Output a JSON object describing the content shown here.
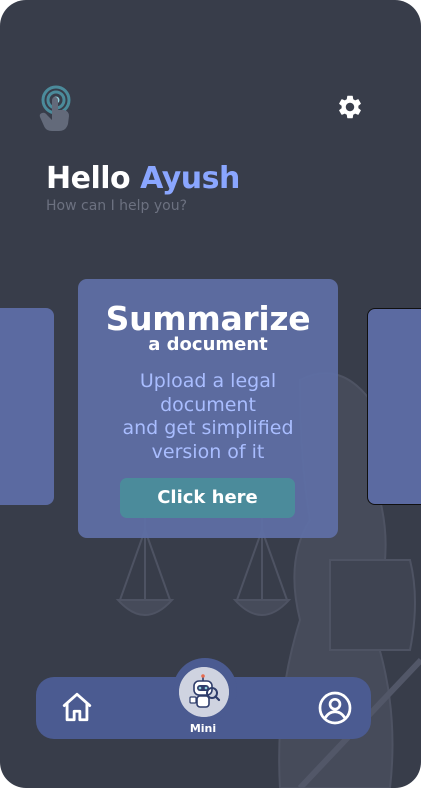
{
  "header": {
    "greeting_prefix": "Hello",
    "user_name": "Ayush",
    "subtitle": "How can I help you?"
  },
  "feature_card": {
    "title": "Summarize",
    "subtitle": "a document",
    "description_lines": [
      "Upload a legal",
      "document",
      "and get simplified",
      "version of it"
    ],
    "button_label": "Click here"
  },
  "bottom_nav": {
    "center_label": "Mini",
    "items": [
      "home-icon",
      "mini-robot-icon",
      "profile-icon"
    ]
  },
  "icons": {
    "logo": "touch-hand-icon",
    "settings": "gear-icon"
  },
  "colors": {
    "background": "#383d4a",
    "accent_name": "#8aa6ff",
    "card": "#5f6ea5",
    "button": "#4b8b9b",
    "nav": "#4b5b91"
  }
}
